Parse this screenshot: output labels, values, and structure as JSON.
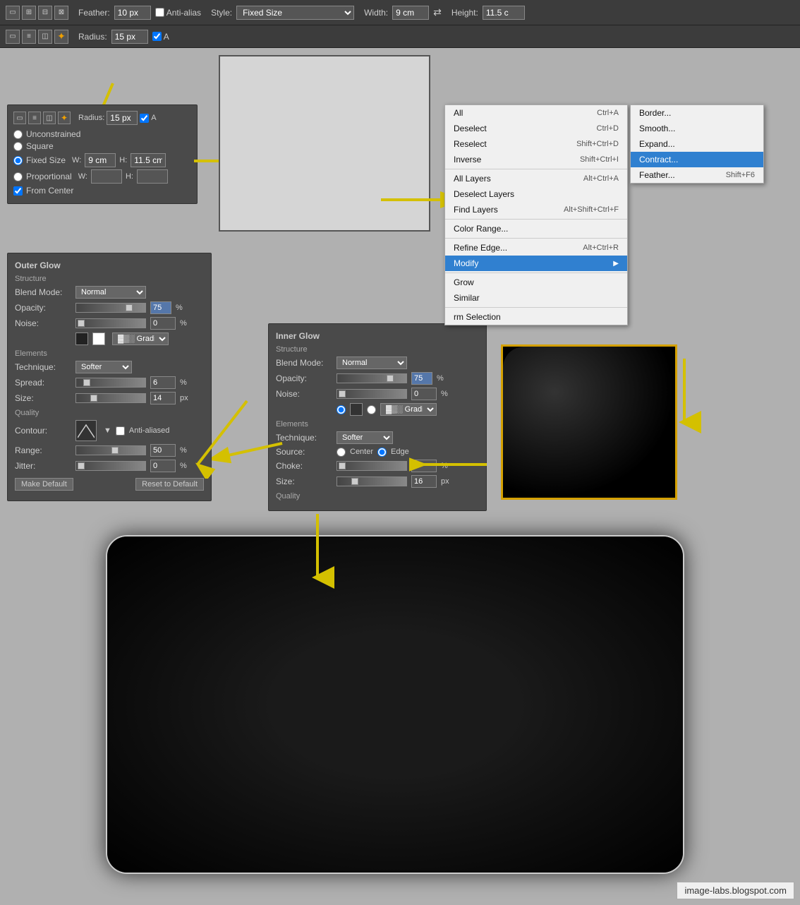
{
  "topToolbar": {
    "icons": [
      "rect-select",
      "add-select",
      "subtract-select",
      "intersect-select"
    ],
    "feather_label": "Feather:",
    "feather_value": "10 px",
    "anti_alias_label": "Anti-alias",
    "style_label": "Style:",
    "style_value": "Fixed Size",
    "width_label": "Width:",
    "width_value": "9 cm",
    "swap_icon": "⇄",
    "height_label": "Height:",
    "height_value": "11.5 c"
  },
  "secondToolbar": {
    "icons": [
      "rect2",
      "row-select",
      "layer-select",
      "magic-wand"
    ],
    "radius_label": "Radius:",
    "radius_value": "15 px"
  },
  "selectionPanel": {
    "options": [
      {
        "id": "unconstrained",
        "label": "Unconstrained"
      },
      {
        "id": "square",
        "label": "Square"
      },
      {
        "id": "fixed-size",
        "label": "Fixed Size",
        "checked": true
      },
      {
        "id": "proportional",
        "label": "Proportional"
      }
    ],
    "w_label": "W:",
    "w_value": "9 cm",
    "h_label": "H:",
    "h_value": "11.5 cm",
    "from_center": "From Center"
  },
  "selectMenu": {
    "items": [
      {
        "label": "All",
        "shortcut": "Ctrl+A"
      },
      {
        "label": "Deselect",
        "shortcut": "Ctrl+D"
      },
      {
        "label": "Reselect",
        "shortcut": "Shift+Ctrl+D"
      },
      {
        "label": "Inverse",
        "shortcut": "Shift+Ctrl+I"
      },
      {
        "divider": true
      },
      {
        "label": "All Layers",
        "shortcut": "Alt+Ctrl+A"
      },
      {
        "label": "Deselect Layers",
        "shortcut": ""
      },
      {
        "label": "Find Layers",
        "shortcut": "Alt+Shift+Ctrl+F"
      },
      {
        "divider": true
      },
      {
        "label": "Color Range...",
        "shortcut": ""
      },
      {
        "divider": true
      },
      {
        "label": "Refine Edge...",
        "shortcut": "Alt+Ctrl+R"
      },
      {
        "label": "Modify",
        "shortcut": "",
        "active": true,
        "hasArrow": true
      },
      {
        "divider": true
      },
      {
        "label": "Grow",
        "shortcut": ""
      },
      {
        "label": "Similar",
        "shortcut": ""
      },
      {
        "divider": true
      },
      {
        "label": "rm Selection",
        "shortcut": ""
      }
    ]
  },
  "modifySubmenu": {
    "items": [
      {
        "label": "Border..."
      },
      {
        "label": "Smooth..."
      },
      {
        "label": "Expand..."
      },
      {
        "label": "Contract...",
        "active": true
      },
      {
        "label": "Feather...",
        "shortcut": "Shift+F6"
      }
    ]
  },
  "outerGlow": {
    "title": "Outer Glow",
    "structure_label": "Structure",
    "blend_mode_label": "Blend Mode:",
    "blend_mode_value": "Normal",
    "opacity_label": "Opacity:",
    "opacity_value": "75",
    "opacity_unit": "%",
    "noise_label": "Noise:",
    "noise_value": "0",
    "noise_unit": "%",
    "elements_label": "Elements",
    "technique_label": "Technique:",
    "technique_value": "Softer",
    "spread_label": "Spread:",
    "spread_value": "6",
    "spread_unit": "%",
    "size_label": "Size:",
    "size_value": "14",
    "size_unit": "px",
    "quality_label": "Quality",
    "contour_label": "Contour:",
    "anti_aliased_label": "Anti-aliased",
    "range_label": "Range:",
    "range_value": "50",
    "range_unit": "%",
    "jitter_label": "Jitter:",
    "jitter_value": "0",
    "jitter_unit": "%",
    "make_default": "Make Default",
    "reset_default": "Reset to Default"
  },
  "innerGlow": {
    "title": "Inner Glow",
    "structure_label": "Structure",
    "blend_mode_label": "Blend Mode:",
    "blend_mode_value": "Normal",
    "opacity_label": "Opacity:",
    "opacity_value": "75",
    "opacity_unit": "%",
    "noise_label": "Noise:",
    "noise_value": "0",
    "noise_unit": "%",
    "elements_label": "Elements",
    "technique_label": "Technique:",
    "technique_value": "Softer",
    "source_label": "Source:",
    "source_center": "Center",
    "source_edge": "Edge",
    "choke_label": "Choke:",
    "choke_value": "0",
    "choke_unit": "%",
    "size_label": "Size:",
    "size_value": "16",
    "size_unit": "px",
    "quality_label": "Quality"
  },
  "watermark": {
    "text": "image-labs.blogspot.com"
  }
}
